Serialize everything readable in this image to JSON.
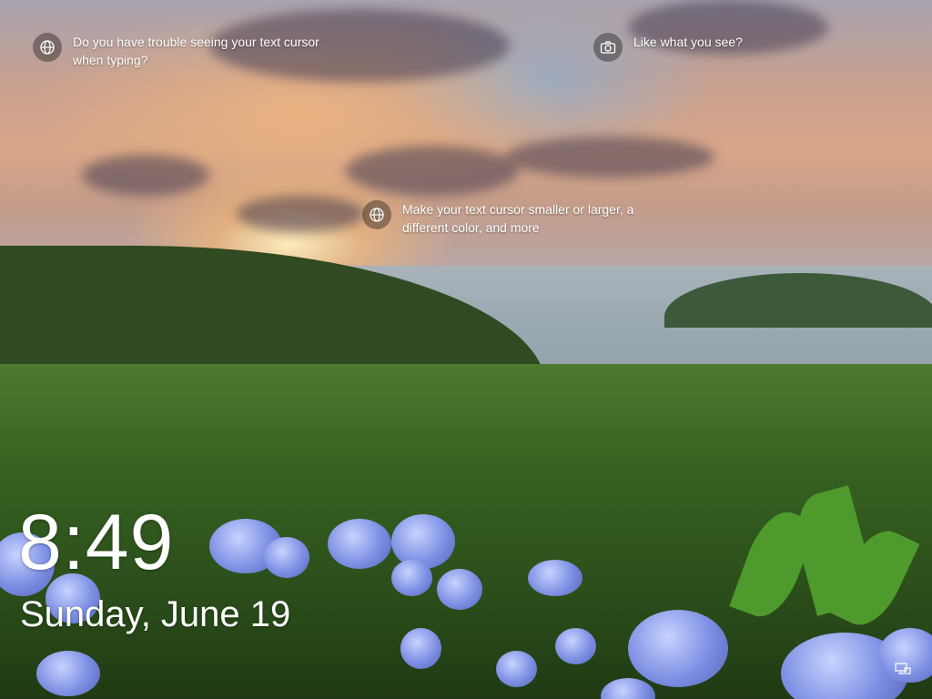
{
  "tips": [
    {
      "icon": "globe-icon",
      "text": "Do you have trouble seeing your text cursor when typing?"
    },
    {
      "icon": "camera-icon",
      "text": "Like what you see?"
    },
    {
      "icon": "globe-icon",
      "text": "Make your text cursor smaller or larger, a different color, and more"
    }
  ],
  "clock": {
    "time": "8:49",
    "date": "Sunday, June 19"
  },
  "status": {
    "network_icon": "network-icon"
  }
}
